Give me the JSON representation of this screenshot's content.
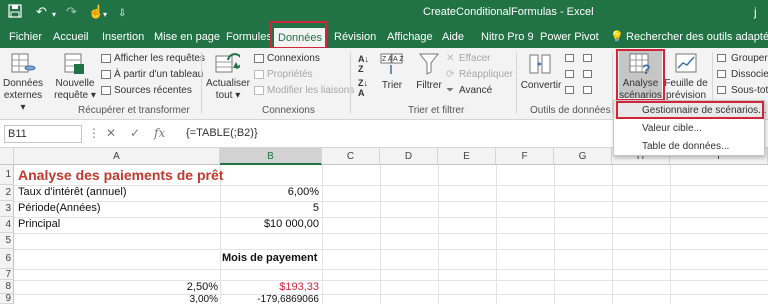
{
  "titlebar": {
    "doc_title": "CreateConditionalFormulas - Excel",
    "user_initial": "j"
  },
  "tabs": [
    {
      "label": "Fichier"
    },
    {
      "label": "Accueil"
    },
    {
      "label": "Insertion"
    },
    {
      "label": "Mise en page"
    },
    {
      "label": "Formules"
    },
    {
      "label": "Données",
      "active": true
    },
    {
      "label": "Révision"
    },
    {
      "label": "Affichage"
    },
    {
      "label": "Aide"
    },
    {
      "label": "Nitro Pro 9"
    },
    {
      "label": "Power Pivot"
    },
    {
      "label": "Rechercher des outils adaptés"
    }
  ],
  "ribbon": {
    "donnees_externes": [
      "Données",
      "externes"
    ],
    "nouvelle_requete": [
      "Nouvelle",
      "requête"
    ],
    "afficher_requetes": "Afficher les requêtes",
    "a_partir_tableau": "À partir d'un tableau",
    "sources_recentes": "Sources récentes",
    "actualiser_tout": [
      "Actualiser",
      "tout"
    ],
    "connexions": "Connexions",
    "proprietes": "Propriétés",
    "modifier_liaisons": "Modifier les liaisons",
    "trier": "Trier",
    "filtrer": "Filtrer",
    "effacer": "Effacer",
    "reappliquer": "Réappliquer",
    "avance": "Avancé",
    "convertir": "Convertir",
    "analyse_scenarios": [
      "Analyse",
      "scénarios"
    ],
    "feuille_prevision": [
      "Feuille de",
      "prévision"
    ],
    "grouper": "Grouper",
    "dissocier": "Dissocier",
    "sous_total": "Sous-tota",
    "groups": {
      "recuperer": "Récupérer et transformer",
      "connexions": "Connexions",
      "trier_filtrer": "Trier et filtrer",
      "outils": "Outils de données"
    }
  },
  "formula_bar": {
    "name_box": "B11",
    "formula": "{=TABLE(;B2)}"
  },
  "grid": {
    "columns": [
      "A",
      "B",
      "C",
      "D",
      "E",
      "F",
      "G",
      "H",
      "I"
    ],
    "rows": [
      "1",
      "2",
      "3",
      "4",
      "5",
      "6",
      "7",
      "8",
      "9"
    ],
    "cells": {
      "A1": "Analyse des paiements de prêt",
      "A2": "Taux d'intérêt (annuel)",
      "B2": "6,00%",
      "A3": "Période(Années)",
      "B3": "5",
      "A4": "Principal",
      "B4": "$10 000,00",
      "B6": "Mois de payement",
      "A8": "2,50%",
      "B8": "$193,33",
      "A9": "3,00%",
      "B9": "-179,6869066"
    }
  },
  "dropdown": {
    "items": [
      "Gestionnaire de scénarios...",
      "Valeur cible...",
      "Table de données..."
    ]
  }
}
